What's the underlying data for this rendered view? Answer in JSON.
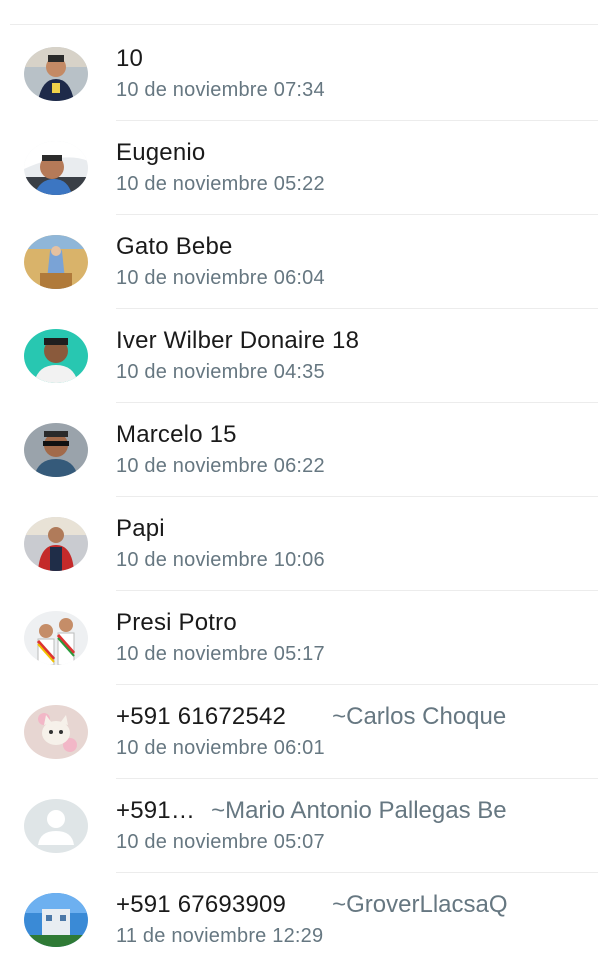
{
  "contacts": [
    {
      "name": "10",
      "time": "10 de noviembre 07:34",
      "avatar": "photo-boy-portrait"
    },
    {
      "name": "Eugenio",
      "time": "10 de noviembre 05:22",
      "avatar": "photo-man-in-car"
    },
    {
      "name": "Gato Bebe",
      "time": "10 de noviembre 06:04",
      "avatar": "photo-religious-image"
    },
    {
      "name": "Iver Wilber Donaire 18",
      "time": "10 de noviembre 04:35",
      "avatar": "photo-man-teal-background"
    },
    {
      "name": "Marcelo 15",
      "time": "10 de noviembre 06:22",
      "avatar": "photo-man-with-sunglasses"
    },
    {
      "name": "Papi",
      "time": "10 de noviembre 10:06",
      "avatar": "photo-person-red-jacket"
    },
    {
      "name": "Presi Potro",
      "time": "10 de noviembre 05:17",
      "avatar": "photo-children-with-sash"
    },
    {
      "name": "+591 61672542",
      "pushname": "~Carlos Choque",
      "time": "10 de noviembre 06:01",
      "avatar": "photo-cat"
    },
    {
      "name": "+591…",
      "pushname": "~Mario Antonio Pallegas Be",
      "time": "10 de noviembre 05:07",
      "avatar": "default-user-icon"
    },
    {
      "name": "+591 67693909",
      "pushname": "~GroverLlacsaQ",
      "time": "11 de noviembre 12:29",
      "avatar": "photo-building-sky"
    }
  ],
  "colors": {
    "secondary_text": "#667781",
    "primary_text": "#1a1a1a",
    "divider": "#ececec",
    "default_avatar_bg": "#dfe5e7"
  }
}
